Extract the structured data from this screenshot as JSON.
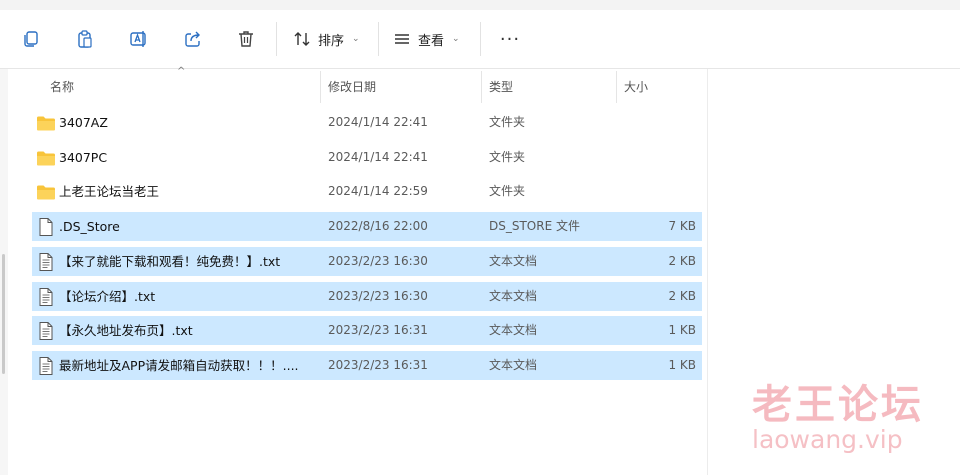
{
  "toolbar": {
    "icons": [
      "copy-icon",
      "paste-icon",
      "rename-icon",
      "share-icon",
      "delete-icon"
    ],
    "sort_label": "排序",
    "view_label": "查看",
    "more_label": "···"
  },
  "columns": {
    "name": "名称",
    "date": "修改日期",
    "type": "类型",
    "size": "大小"
  },
  "files": [
    {
      "name": "3407AZ",
      "date": "2024/1/14 22:41",
      "type": "文件夹",
      "size": "",
      "kind": "folder",
      "selected": false
    },
    {
      "name": "3407PC",
      "date": "2024/1/14 22:41",
      "type": "文件夹",
      "size": "",
      "kind": "folder",
      "selected": false
    },
    {
      "name": "上老王论坛当老王",
      "date": "2024/1/14 22:59",
      "type": "文件夹",
      "size": "",
      "kind": "folder",
      "selected": false
    },
    {
      "name": ".DS_Store",
      "date": "2022/8/16 22:00",
      "type": "DS_STORE 文件",
      "size": "7 KB",
      "kind": "file",
      "selected": true
    },
    {
      "name": "【来了就能下载和观看！纯免费！】.txt",
      "date": "2023/2/23 16:30",
      "type": "文本文档",
      "size": "2 KB",
      "kind": "text",
      "selected": true
    },
    {
      "name": "【论坛介绍】.txt",
      "date": "2023/2/23 16:30",
      "type": "文本文档",
      "size": "2 KB",
      "kind": "text",
      "selected": true
    },
    {
      "name": "【永久地址发布页】.txt",
      "date": "2023/2/23 16:31",
      "type": "文本文档",
      "size": "1 KB",
      "kind": "text",
      "selected": true
    },
    {
      "name": "最新地址及APP请发邮箱自动获取！！！....",
      "date": "2023/2/23 16:31",
      "type": "文本文档",
      "size": "1 KB",
      "kind": "text",
      "selected": true
    }
  ],
  "watermark": {
    "line1": "老王论坛",
    "line2": "laowang.vip"
  },
  "colors": {
    "selection": "#cce8ff",
    "folder": "#f8c43a",
    "watermark": "#ec828c"
  }
}
